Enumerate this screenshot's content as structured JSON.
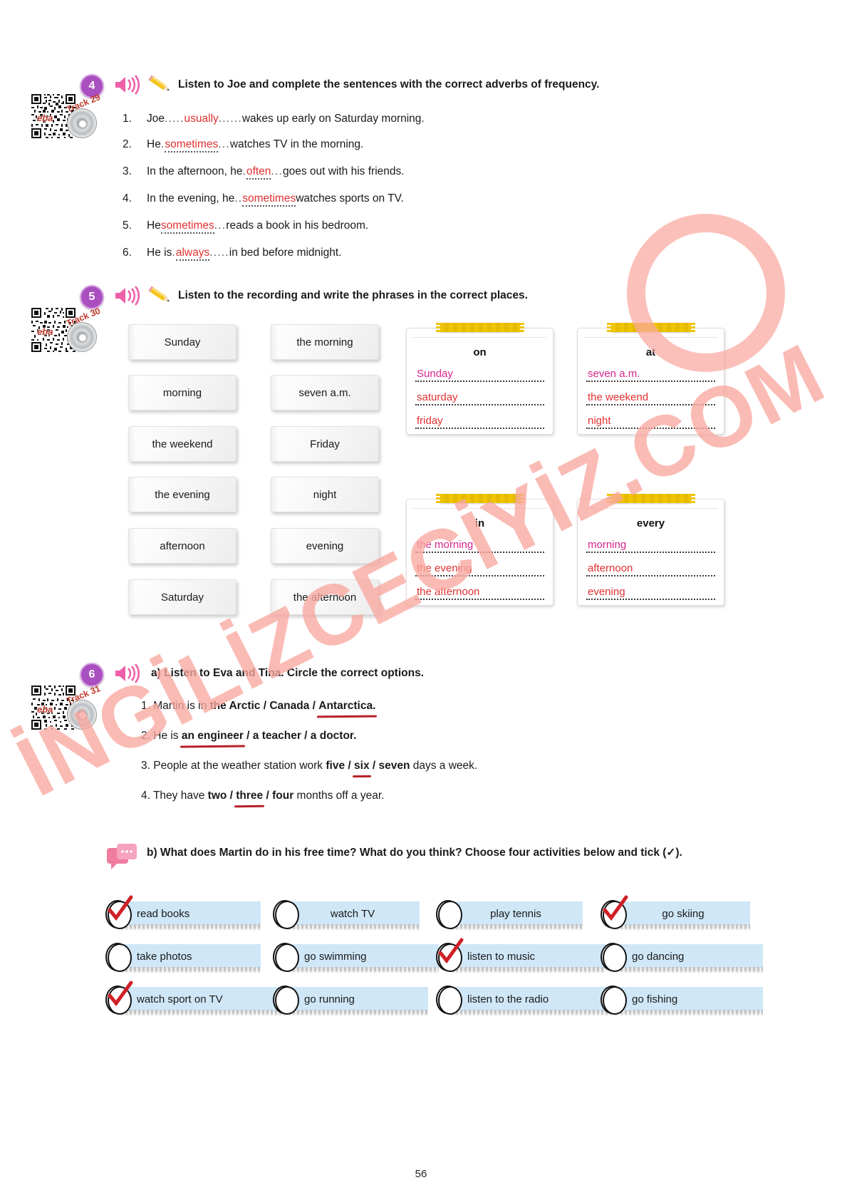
{
  "page": {
    "number": "56"
  },
  "watermark": {
    "text": "İNGİLİZCECİYİZ.COM"
  },
  "exercise4": {
    "number": "4",
    "track": "Track 29",
    "ebaword": "eba",
    "instruction": "Listen to Joe and complete the sentences with the correct adverbs of frequency.",
    "items": [
      {
        "index": "1.",
        "before": "Joe ",
        "dots_before": ".....",
        "answer": "usually",
        "dots_after": "......",
        "after": "wakes up early on Saturday morning."
      },
      {
        "index": "2.",
        "before": "He ",
        "dots_before": ".",
        "answer": "sometimes",
        "dots_after": "...",
        "after": " watches TV in the morning."
      },
      {
        "index": "3.",
        "before": "In the afternoon, he ",
        "dots_before": ".",
        "answer": "often",
        "dots_after": "...",
        "after": " goes out with his friends."
      },
      {
        "index": "4.",
        "before": "In the evening, he ",
        "dots_before": "..",
        "answer": "sometimes",
        "dots_after": "",
        "after": "watches sports on TV."
      },
      {
        "index": "5.",
        "before": "He ",
        "dots_before": "",
        "answer": "sometimes",
        "dots_after": "...",
        "after": " reads a book in his bedroom."
      },
      {
        "index": "6.",
        "before": "He is ",
        "dots_before": ".",
        "answer": "always",
        "dots_after": ".....",
        "after": " in bed before midnight."
      }
    ]
  },
  "exercise5": {
    "number": "5",
    "track": "Track 30",
    "ebaword": "eba",
    "instruction": "Listen to the recording and write the phrases in the correct places.",
    "cards_left": [
      "Sunday",
      "morning",
      "the weekend",
      "the evening",
      "afternoon",
      "Saturday"
    ],
    "cards_right": [
      "the morning",
      "seven a.m.",
      "Friday",
      "night",
      "evening",
      "the afternoon"
    ],
    "boxes": [
      {
        "title": "on",
        "answers": [
          {
            "text": "Sunday",
            "color": "pink"
          },
          {
            "text": "saturday",
            "color": "red"
          },
          {
            "text": "friday",
            "color": "red"
          }
        ]
      },
      {
        "title": "at",
        "answers": [
          {
            "text": "seven a.m.",
            "color": "pink"
          },
          {
            "text": "the weekend",
            "color": "red"
          },
          {
            "text": "night",
            "color": "red"
          }
        ]
      },
      {
        "title": "in",
        "answers": [
          {
            "text": "the morning",
            "color": "pink"
          },
          {
            "text": "the evening",
            "color": "red"
          },
          {
            "text": "the afternoon",
            "color": "red"
          }
        ]
      },
      {
        "title": "every",
        "answers": [
          {
            "text": "morning",
            "color": "pink"
          },
          {
            "text": "afternoon",
            "color": "red"
          },
          {
            "text": "evening",
            "color": "red"
          }
        ]
      }
    ]
  },
  "exercise6": {
    "number": "6",
    "track": "Track 31",
    "ebaword": "eba",
    "instruction_a": "a) Listen to Eva and Tina. Circle the correct options.",
    "items": [
      {
        "index": "1.",
        "lead": "Martin is in ",
        "options": [
          "the Arctic",
          "Canada",
          "Antarctica."
        ],
        "selected": 2
      },
      {
        "index": "2.",
        "lead": "He is ",
        "options": [
          "an engineer",
          "a teacher",
          "a doctor."
        ],
        "selected": 0
      },
      {
        "index": "3.",
        "lead": "People at the weather station work ",
        "options": [
          "five",
          "six",
          "seven"
        ],
        "selected": 1,
        "tail": " days a week."
      },
      {
        "index": "4.",
        "lead": "They have ",
        "options": [
          "two",
          "three",
          "four"
        ],
        "selected": 1,
        "tail": " months off a year."
      }
    ],
    "instruction_b": "b) What does Martin do in his free time? What do you think? Choose four activities below and tick (✓).",
    "activities": [
      {
        "label": "read books",
        "ticked": true
      },
      {
        "label": "watch TV",
        "ticked": false
      },
      {
        "label": "play tennis",
        "ticked": false
      },
      {
        "label": "go skiing",
        "ticked": true
      },
      {
        "label": "take photos",
        "ticked": false
      },
      {
        "label": "go swimming",
        "ticked": false
      },
      {
        "label": "listen to music",
        "ticked": true
      },
      {
        "label": "go dancing",
        "ticked": false
      },
      {
        "label": "watch sport on TV",
        "ticked": true
      },
      {
        "label": "go running",
        "ticked": false
      },
      {
        "label": "listen to the radio",
        "ticked": false
      },
      {
        "label": "go fishing",
        "ticked": false
      }
    ]
  },
  "colors": {
    "badge": "#a94fbf",
    "answer_red": "#e03131",
    "answer_pink": "#d6258c",
    "underline": "#b52127",
    "pill": "#cfe7f7",
    "tape": "#f0c400",
    "watermark": "#f9a8a0"
  }
}
